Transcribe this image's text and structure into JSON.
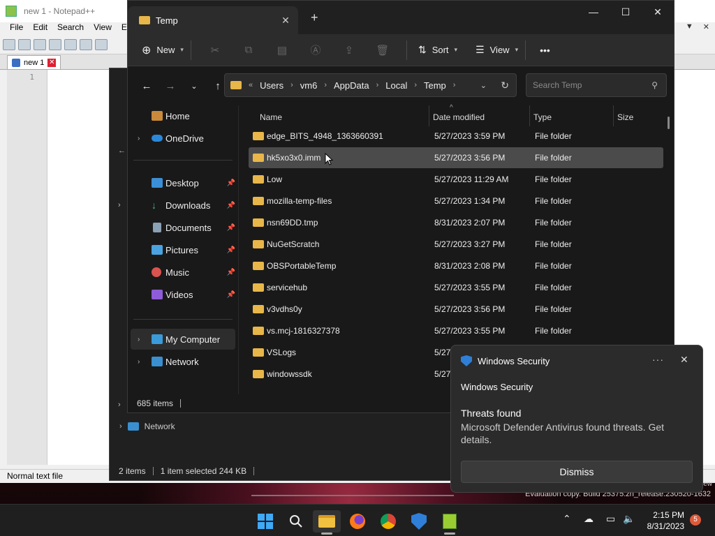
{
  "notepad": {
    "title": "new 1 - Notepad++",
    "menu": [
      "File",
      "Edit",
      "Search",
      "View",
      "En"
    ],
    "menu_right_arrow": "▼",
    "menu_right_close": "✕",
    "tab_label": "new 1",
    "line_number": "1",
    "status": "Normal text file"
  },
  "bg_explorer": {
    "status_items": "2 items",
    "status_selected": "1 item selected  244 KB",
    "network_label": "Network"
  },
  "explorer": {
    "tab_title": "Temp",
    "toolbar": {
      "new_label": "New",
      "sort_label": "Sort",
      "view_label": "View",
      "more_label": "•••"
    },
    "breadcrumb": [
      "Users",
      "vm6",
      "AppData",
      "Local",
      "Temp"
    ],
    "breadcrumb_prefix": "«",
    "search_placeholder": "Search Temp",
    "sidebar": {
      "home": "Home",
      "onedrive": "OneDrive",
      "desktop": "Desktop",
      "downloads": "Downloads",
      "documents": "Documents",
      "pictures": "Pictures",
      "music": "Music",
      "videos": "Videos",
      "my_computer": "My Computer",
      "network": "Network"
    },
    "columns": {
      "name": "Name",
      "date": "Date modified",
      "type": "Type",
      "size": "Size"
    },
    "files": [
      {
        "name": "edge_BITS_4948_1363660391",
        "date": "5/27/2023 3:59 PM",
        "type": "File folder"
      },
      {
        "name": "hk5xo3x0.imm",
        "date": "5/27/2023 3:56 PM",
        "type": "File folder"
      },
      {
        "name": "Low",
        "date": "5/27/2023 11:29 AM",
        "type": "File folder"
      },
      {
        "name": "mozilla-temp-files",
        "date": "5/27/2023 1:34 PM",
        "type": "File folder"
      },
      {
        "name": "nsn69DD.tmp",
        "date": "8/31/2023 2:07 PM",
        "type": "File folder"
      },
      {
        "name": "NuGetScratch",
        "date": "5/27/2023 3:27 PM",
        "type": "File folder"
      },
      {
        "name": "OBSPortableTemp",
        "date": "8/31/2023 2:08 PM",
        "type": "File folder"
      },
      {
        "name": "servicehub",
        "date": "5/27/2023 3:55 PM",
        "type": "File folder"
      },
      {
        "name": "v3vdhs0y",
        "date": "5/27/2023 3:56 PM",
        "type": "File folder"
      },
      {
        "name": "vs.mcj-1816327378",
        "date": "5/27/2023 3:55 PM",
        "type": "File folder"
      },
      {
        "name": "VSLogs",
        "date": "5/27/",
        "type": ""
      },
      {
        "name": "windowssdk",
        "date": "5/27/",
        "type": ""
      }
    ],
    "status_count": "685 items"
  },
  "toast": {
    "header": "Windows Security",
    "more": "···",
    "app_name": "Windows Security",
    "title": "Threats found",
    "body": "Microsoft Defender Antivirus found threats. Get details.",
    "button": "Dismiss"
  },
  "watermark": "Evaluation copy. Build 25375.zn_release.230520-1632",
  "watermark_top": "ew",
  "taskbar": {
    "time": "2:15 PM",
    "date": "8/31/2023",
    "badge": "5"
  }
}
